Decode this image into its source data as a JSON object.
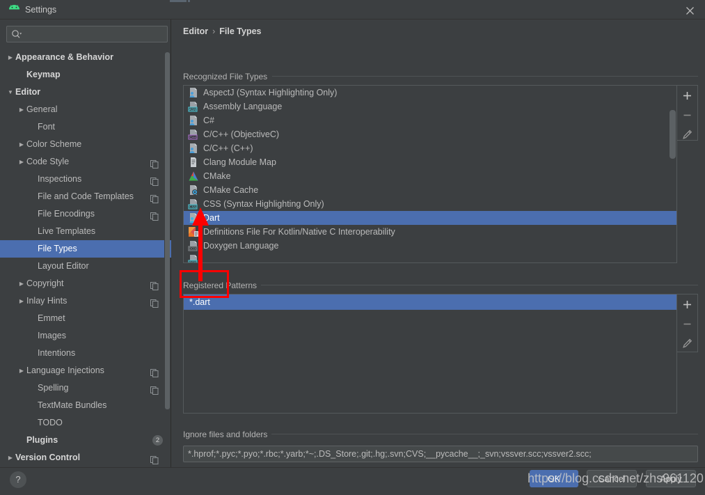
{
  "window": {
    "title": "Settings",
    "app_icon": "android-icon",
    "close_icon": "close-icon"
  },
  "sidebar": {
    "search": {
      "placeholder": "",
      "value": "",
      "icon": "search-icon"
    },
    "items": [
      {
        "label": "Appearance & Behavior",
        "indent": 0,
        "arrow": "right",
        "bold": true,
        "selected": false,
        "copy": false
      },
      {
        "label": "Keymap",
        "indent": 1,
        "arrow": "none",
        "bold": true,
        "selected": false,
        "copy": false
      },
      {
        "label": "Editor",
        "indent": 0,
        "arrow": "down",
        "bold": true,
        "selected": false,
        "copy": false
      },
      {
        "label": "General",
        "indent": 1,
        "arrow": "right",
        "bold": false,
        "selected": false,
        "copy": false
      },
      {
        "label": "Font",
        "indent": 2,
        "arrow": "none",
        "bold": false,
        "selected": false,
        "copy": false
      },
      {
        "label": "Color Scheme",
        "indent": 1,
        "arrow": "right",
        "bold": false,
        "selected": false,
        "copy": false
      },
      {
        "label": "Code Style",
        "indent": 1,
        "arrow": "right",
        "bold": false,
        "selected": false,
        "copy": true
      },
      {
        "label": "Inspections",
        "indent": 2,
        "arrow": "none",
        "bold": false,
        "selected": false,
        "copy": true
      },
      {
        "label": "File and Code Templates",
        "indent": 2,
        "arrow": "none",
        "bold": false,
        "selected": false,
        "copy": true
      },
      {
        "label": "File Encodings",
        "indent": 2,
        "arrow": "none",
        "bold": false,
        "selected": false,
        "copy": true
      },
      {
        "label": "Live Templates",
        "indent": 2,
        "arrow": "none",
        "bold": false,
        "selected": false,
        "copy": false
      },
      {
        "label": "File Types",
        "indent": 2,
        "arrow": "none",
        "bold": false,
        "selected": true,
        "copy": false
      },
      {
        "label": "Layout Editor",
        "indent": 2,
        "arrow": "none",
        "bold": false,
        "selected": false,
        "copy": false
      },
      {
        "label": "Copyright",
        "indent": 1,
        "arrow": "right",
        "bold": false,
        "selected": false,
        "copy": true
      },
      {
        "label": "Inlay Hints",
        "indent": 1,
        "arrow": "right",
        "bold": false,
        "selected": false,
        "copy": true
      },
      {
        "label": "Emmet",
        "indent": 2,
        "arrow": "none",
        "bold": false,
        "selected": false,
        "copy": false
      },
      {
        "label": "Images",
        "indent": 2,
        "arrow": "none",
        "bold": false,
        "selected": false,
        "copy": false
      },
      {
        "label": "Intentions",
        "indent": 2,
        "arrow": "none",
        "bold": false,
        "selected": false,
        "copy": false
      },
      {
        "label": "Language Injections",
        "indent": 1,
        "arrow": "right",
        "bold": false,
        "selected": false,
        "copy": true
      },
      {
        "label": "Spelling",
        "indent": 2,
        "arrow": "none",
        "bold": false,
        "selected": false,
        "copy": true
      },
      {
        "label": "TextMate Bundles",
        "indent": 2,
        "arrow": "none",
        "bold": false,
        "selected": false,
        "copy": false
      },
      {
        "label": "TODO",
        "indent": 2,
        "arrow": "none",
        "bold": false,
        "selected": false,
        "copy": false
      },
      {
        "label": "Plugins",
        "indent": 1,
        "arrow": "none",
        "bold": true,
        "selected": false,
        "copy": false,
        "badge": "2"
      },
      {
        "label": "Version Control",
        "indent": 0,
        "arrow": "right",
        "bold": true,
        "selected": false,
        "copy": true
      }
    ]
  },
  "main": {
    "breadcrumb": {
      "parent": "Editor",
      "separator": "›",
      "current": "File Types"
    },
    "recognized_group_label": "Recognized File Types",
    "registered_group_label": "Registered Patterns",
    "ignore_group_label": "Ignore files and folders",
    "file_types": [
      {
        "label": "AspectJ (Syntax Highlighting Only)",
        "icon": "aspectj-filetype-icon",
        "selected": false
      },
      {
        "label": "Assembly Language",
        "icon": "asm-filetype-icon",
        "selected": false
      },
      {
        "label": "C#",
        "icon": "csharp-filetype-icon",
        "selected": false
      },
      {
        "label": "C/C++ (ObjectiveC)",
        "icon": "cpp-objc-filetype-icon",
        "selected": false
      },
      {
        "label": "C/C++ (C++)",
        "icon": "cpp-filetype-icon",
        "selected": false
      },
      {
        "label": "Clang Module Map",
        "icon": "clang-module-map-icon",
        "selected": false
      },
      {
        "label": "CMake",
        "icon": "cmake-filetype-icon",
        "selected": false
      },
      {
        "label": "CMake Cache",
        "icon": "cmake-cache-filetype-icon",
        "selected": false
      },
      {
        "label": "CSS (Syntax Highlighting Only)",
        "icon": "css-filetype-icon",
        "selected": false
      },
      {
        "label": "Dart",
        "icon": "dart-filetype-icon",
        "selected": true
      },
      {
        "label": "Definitions File For Kotlin/Native C Interoperability",
        "icon": "kotlin-def-filetype-icon",
        "selected": false
      },
      {
        "label": "Doxygen Language",
        "icon": "doxygen-filetype-icon",
        "selected": false
      }
    ],
    "patterns": [
      {
        "label": "*.dart",
        "selected": true
      }
    ],
    "ignore_value": "*.hprof;*.pyc;*.pyo;*.rbc;*.yarb;*~;.DS_Store;.git;.hg;.svn;CVS;__pycache__;_svn;vssver.scc;vssver2.scc;",
    "toolbar": {
      "add_label": "+",
      "remove_label": "−",
      "edit_label": "edit-pencil-icon"
    }
  },
  "footer": {
    "help_label": "?",
    "ok_label": "OK",
    "cancel_label": "Cancel",
    "apply_label": "Apply"
  },
  "annotations": {
    "watermark": "https://blog.csdn.net/zhs961120",
    "accent": "#fe0000",
    "selection_color": "#4b6eaf"
  }
}
